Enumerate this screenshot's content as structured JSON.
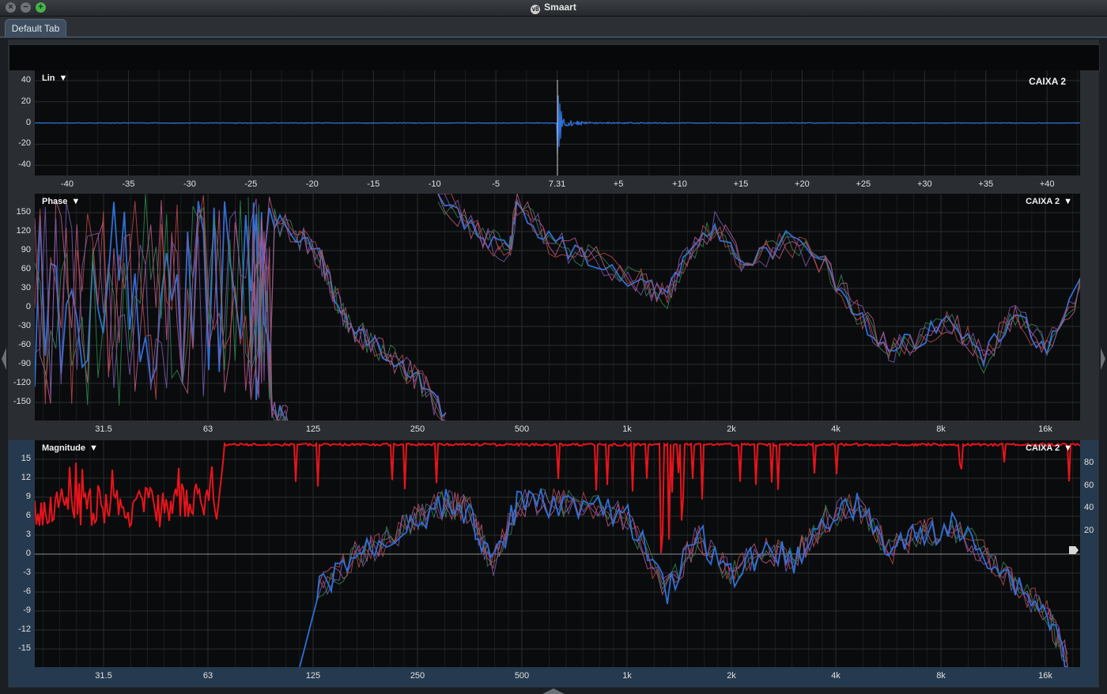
{
  "window": {
    "title": "Smaart"
  },
  "tabs": [
    {
      "label": "Default Tab"
    }
  ],
  "colors": {
    "trace_blue": "#2f6fd6",
    "trace_red": "#e8141c",
    "trace_green": "#2f8a52",
    "trace_pink": "#c05a8a",
    "grid": "#2a2d31",
    "plot_bg": "#0a0b0c"
  },
  "ir_plot": {
    "title": "Lin",
    "trace_label": "CAIXA 2",
    "y_ticks": [
      "40",
      "20",
      "0",
      "-20",
      "-40"
    ],
    "x_ticks": [
      "-40",
      "-35",
      "-30",
      "-25",
      "-20",
      "-15",
      "-10",
      "-5",
      "7.31",
      "+5",
      "+10",
      "+15",
      "+20",
      "+25",
      "+30",
      "+35",
      "+40"
    ]
  },
  "phase_plot": {
    "title": "Phase",
    "trace_label": "CAIXA 2",
    "y_ticks": [
      "150",
      "120",
      "90",
      "60",
      "30",
      "0",
      "-30",
      "-60",
      "-90",
      "-120",
      "-150"
    ],
    "x_ticks": [
      "31.5",
      "63",
      "125",
      "250",
      "500",
      "1k",
      "2k",
      "4k",
      "8k",
      "16k"
    ]
  },
  "magnitude_plot": {
    "title": "Magnitude",
    "trace_label": "CAIXA 2",
    "y_ticks": [
      "15",
      "12",
      "9",
      "6",
      "3",
      "0",
      "-3",
      "-6",
      "-9",
      "-12",
      "-15"
    ],
    "y_ticks_right": [
      "80",
      "60",
      "40",
      "20"
    ],
    "x_ticks": [
      "31.5",
      "63",
      "125",
      "250",
      "500",
      "1k",
      "2k",
      "4k",
      "8k",
      "16k"
    ]
  }
}
